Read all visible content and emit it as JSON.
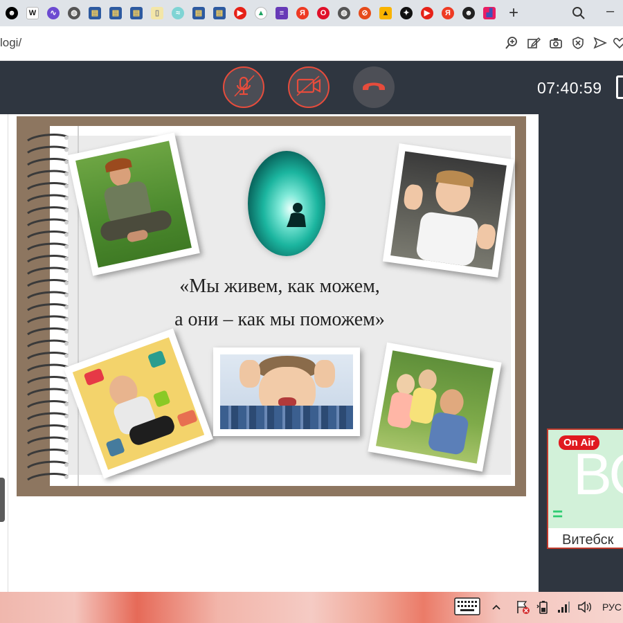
{
  "browser": {
    "url": "logi/",
    "tab_favicons": [
      {
        "name": "smiley-face-icon",
        "glyph": "☻",
        "color": "#000000",
        "fg": "#ffffff"
      },
      {
        "name": "wikipedia-icon",
        "glyph": "W",
        "color": "#ffffff",
        "fg": "#111111"
      },
      {
        "name": "purple-logo-icon",
        "glyph": "∿",
        "color": "#6c4ad1",
        "fg": "#ffffff"
      },
      {
        "name": "globe-icon",
        "glyph": "◍",
        "color": "#555555",
        "fg": "#ffffff"
      },
      {
        "name": "bookmark-blue-icon",
        "glyph": "▤",
        "color": "#2d5aa0",
        "fg": "#ffd45a"
      },
      {
        "name": "bookmark-blue-icon",
        "glyph": "▤",
        "color": "#2d5aa0",
        "fg": "#ffd45a"
      },
      {
        "name": "bookmark-blue-icon",
        "glyph": "▤",
        "color": "#2d5aa0",
        "fg": "#ffd45a"
      },
      {
        "name": "document-icon",
        "glyph": "▯",
        "color": "#f3e6a8",
        "fg": "#888888"
      },
      {
        "name": "teal-app-icon",
        "glyph": "≈",
        "color": "#7fd4d4",
        "fg": "#ffffff"
      },
      {
        "name": "bookmark-blue-icon",
        "glyph": "▤",
        "color": "#2d5aa0",
        "fg": "#ffd45a"
      },
      {
        "name": "bookmark-blue-icon",
        "glyph": "▤",
        "color": "#2d5aa0",
        "fg": "#ffd45a"
      },
      {
        "name": "youtube-icon",
        "glyph": "▶",
        "color": "#e62117",
        "fg": "#ffffff"
      },
      {
        "name": "google-drive-icon",
        "glyph": "▲",
        "color": "#ffffff",
        "fg": "#1fa463"
      },
      {
        "name": "forms-icon",
        "glyph": "≡",
        "color": "#673ab7",
        "fg": "#ffffff"
      },
      {
        "name": "yandex-icon",
        "glyph": "Я",
        "color": "#ee3a23",
        "fg": "#ffffff"
      },
      {
        "name": "opera-icon",
        "glyph": "O",
        "color": "#e0102a",
        "fg": "#ffffff"
      },
      {
        "name": "globe-icon",
        "glyph": "◍",
        "color": "#555555",
        "fg": "#ffffff"
      },
      {
        "name": "compass-icon",
        "glyph": "⊘",
        "color": "#e64a19",
        "fg": "#ffffff"
      },
      {
        "name": "image-icon",
        "glyph": "▲",
        "color": "#f9b300",
        "fg": "#222222"
      },
      {
        "name": "north-star-icon",
        "glyph": "✦",
        "color": "#111111",
        "fg": "#ffffff"
      },
      {
        "name": "youtube-icon",
        "glyph": "▶",
        "color": "#e62117",
        "fg": "#ffffff"
      },
      {
        "name": "yandex-icon",
        "glyph": "Я",
        "color": "#ee3a23",
        "fg": "#ffffff"
      },
      {
        "name": "avatar-face-icon",
        "glyph": "☻",
        "color": "#222222",
        "fg": "#ffffff"
      },
      {
        "name": "stats-icon",
        "glyph": "▟",
        "color": "#e91e63",
        "fg": "#3f51b5"
      }
    ],
    "new_tab_label": "+",
    "window_min_label": "–"
  },
  "call": {
    "clock": "07:40:59",
    "colors": {
      "toolbar": "#2f3640",
      "mute_ring": "#e74c3c",
      "hangup": "#e74c3c"
    }
  },
  "slide": {
    "quote_line1": "«Мы живем, как можем,",
    "quote_line2": "а они – как мы поможем»"
  },
  "participant": {
    "badge": "On Air",
    "initials": "ВС",
    "speaker_mark": "=",
    "name": "Витебск"
  },
  "taskbar": {
    "language": "РУС"
  }
}
